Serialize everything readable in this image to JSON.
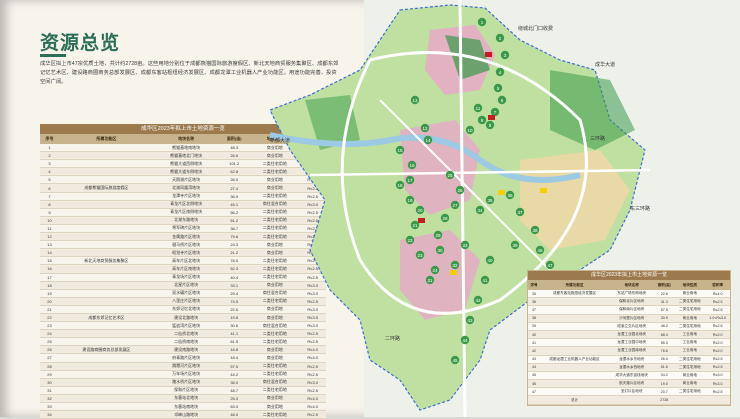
{
  "left_page": {
    "title": "资源总览",
    "intro": "成华区拟上市47宗优质土地，共计约2728亩。这些用地分别位于成都熊猫国际旅游度假区、新北天地商贸服务集聚区、成都东郊记忆艺术区、建设路商圈商务总部发展区、成都东客站枢纽经济发展区、成都龙潭工业机器人产业功能区，用途功能完善，投资空间广阔。",
    "table_title": "成华区2023年拟上市土地资源一览",
    "headers": [
      "序号",
      "所属功能区",
      "地块名称",
      "面积(亩)",
      "地块性质",
      "容积率"
    ],
    "rows": [
      [
        "1",
        "",
        "熊猫基地南地块",
        "48.3",
        "商业用地",
        "R≤2.0"
      ],
      [
        "2",
        "",
        "熊猫基地北门地块",
        "26.6",
        "商业用地",
        "R≤2.0"
      ],
      [
        "3",
        "",
        "熊猫大道西侧地块",
        "101.2",
        "二类住宅用地",
        "R≤2.5"
      ],
      [
        "4",
        "",
        "熊猫大道东侧地块",
        "62.8",
        "二类住宅用地",
        "R≤2.5"
      ],
      [
        "5",
        "",
        "天鹅湖片区地块",
        "26.0",
        "商业用地",
        "R≤3.0"
      ],
      [
        "6",
        "成都熊猫国际旅游度假区",
        "北湖凤凰湾地块",
        "27.4",
        "商业用地",
        "R≤2.0"
      ],
      [
        "7",
        "",
        "龙潭寺片区地块",
        "36.9",
        "二类住宅用地",
        "R≤2.5"
      ],
      [
        "8",
        "",
        "青龙片区北侧地块",
        "45.1",
        "商住混合用地",
        "R≤3.0"
      ],
      [
        "9",
        "",
        "青龙片区南侧地块",
        "56.2",
        "二类住宅用地",
        "R≤2.5"
      ],
      [
        "10",
        "",
        "北湖东路地块",
        "51.2",
        "二类住宅用地",
        "R≤2.5"
      ],
      [
        "11",
        "",
        "将军碑片区地块",
        "38.7",
        "二类住宅用地",
        "R≤2.5"
      ],
      [
        "12",
        "",
        "金属路片区地块",
        "79.6",
        "二类住宅用地",
        "R≤2.5"
      ],
      [
        "13",
        "",
        "驷马桥片区地块",
        "24.3",
        "商业用地",
        "R≤3.5"
      ],
      [
        "14",
        "",
        "昭觉寺片区地块",
        "21.2",
        "商业用地",
        "R≤3.0"
      ],
      [
        "15",
        "新北天地商贸服务集聚区",
        "高车片区北地块",
        "78.0",
        "二类住宅用地",
        "R≤2.5"
      ],
      [
        "16",
        "",
        "高车片区南地块",
        "52.3",
        "二类住宅用地",
        "R≤2.5"
      ],
      [
        "17",
        "",
        "青龙场片区地块",
        "40.4",
        "二类住宅用地",
        "R≤2.5"
      ],
      [
        "18",
        "",
        "北星片区地块",
        "33.1",
        "商业用地",
        "R≤3.0"
      ],
      [
        "19",
        "",
        "双水碾片区地块",
        "29.4",
        "商住混合用地",
        "R≤3.0"
      ],
      [
        "20",
        "",
        "八里庄片区地块",
        "74.5",
        "二类住宅用地",
        "R≤2.5"
      ],
      [
        "21",
        "",
        "东郊记忆北地块",
        "22.6",
        "商业用地",
        "R≤3.0"
      ],
      [
        "22",
        "成都东郊记忆艺术区",
        "建设北路地块",
        "19.6",
        "商业用地",
        "R≤3.5"
      ],
      [
        "23",
        "",
        "猛追湾片区地块",
        "30.6",
        "商住混合用地",
        "R≤3.0"
      ],
      [
        "24",
        "",
        "二仙桥北地块",
        "41.1",
        "二类住宅用地",
        "R≤2.5"
      ],
      [
        "25",
        "",
        "二仙桥南地块",
        "61.5",
        "二类住宅用地",
        "R≤2.5"
      ],
      [
        "26",
        "建设路商圈商务总部发展区",
        "建设南路地块",
        "16.8",
        "商业用地",
        "R≤4.0"
      ],
      [
        "27",
        "",
        "府青路片区地块",
        "18.4",
        "商业用地",
        "R≤4.0"
      ],
      [
        "28",
        "",
        "跳蹬河片区地块",
        "57.9",
        "二类住宅用地",
        "R≤2.5"
      ],
      [
        "29",
        "",
        "万年场片区地块",
        "44.2",
        "二类住宅用地",
        "R≤2.5"
      ],
      [
        "30",
        "",
        "踏水桥片区地块",
        "36.0",
        "商住混合用地",
        "R≤3.0"
      ],
      [
        "31",
        "",
        "保和片区地块",
        "48.7",
        "二类住宅用地",
        "R≤2.5"
      ],
      [
        "32",
        "",
        "东客站北地块",
        "25.3",
        "商业用地",
        "R≤4.0"
      ],
      [
        "33",
        "",
        "东客站南地块",
        "63.0",
        "商业用地",
        "R≤4.0"
      ],
      [
        "34",
        "",
        "邛崃山路地块",
        "48.0",
        "二类住宅用地",
        "R≤2.5"
      ]
    ]
  },
  "right_table": {
    "title": "成华区2023年拟上市土地资源一览",
    "headers": [
      "序号",
      "所属功能区",
      "地块名称",
      "面积(亩)",
      "地块性质",
      "容积率"
    ],
    "rows": [
      [
        "35",
        "成都东客站枢纽经济发展区",
        "东站广场东侧地块",
        "22.6",
        "商业用地",
        "R≤4.0"
      ],
      [
        "36",
        "",
        "保和北片区地块",
        "41.3",
        "二类住宅用地",
        "R≤2.5"
      ],
      [
        "37",
        "",
        "保和南片区地块",
        "57.5",
        "二类住宅用地",
        "R≤2.5"
      ],
      [
        "38",
        "",
        "沙河堡片区地块",
        "30.9",
        "商业用地",
        "1.0<R≤3.0"
      ],
      [
        "39",
        "",
        "成渝立交片区地块",
        "48.2",
        "二类住宅用地",
        "R≤2.5"
      ],
      [
        "40",
        "",
        "龙潭工业园北地块",
        "68.4",
        "工业用地",
        "R≤2.0"
      ],
      [
        "41",
        "",
        "龙潭工业园中地块",
        "55.3",
        "工业用地",
        "R≤2.0"
      ],
      [
        "42",
        "",
        "龙潭工业园南地块",
        "78.6",
        "工业用地",
        "R≤2.0"
      ],
      [
        "43",
        "成都龙潭工业机器人产业功能区",
        "龙潭水乡东地块",
        "26.4",
        "二类住宅用地",
        "R≤2.5"
      ],
      [
        "44",
        "",
        "龙潭水乡西地块",
        "51.8",
        "二类住宅用地",
        "R≤2.5"
      ],
      [
        "45",
        "",
        "成华大道东延线地块",
        "34.2",
        "商业用地",
        "R≤3.0"
      ],
      [
        "46",
        "",
        "航天路片区地块",
        "19.0",
        "商业用地",
        "R≤3.0"
      ],
      [
        "47",
        "",
        "圣灯片区地块",
        "20.7",
        "二类住宅用地",
        "R≤2.5"
      ],
      [
        "",
        "总计",
        "",
        "2728",
        "",
        ""
      ]
    ]
  },
  "map": {
    "road_labels": [
      "绕城北门口收费",
      "成华大道",
      "新都大道",
      "三环路",
      "二环路",
      "东三环路"
    ],
    "parcel_numbers": [
      "1",
      "2",
      "3",
      "4",
      "5",
      "6",
      "7",
      "8",
      "9",
      "10",
      "11",
      "12",
      "13",
      "14",
      "15",
      "16",
      "17",
      "18",
      "19",
      "20",
      "21",
      "22",
      "23",
      "24",
      "25",
      "26",
      "27",
      "28",
      "29",
      "30",
      "31",
      "32",
      "33",
      "34",
      "35",
      "36",
      "37",
      "38",
      "39",
      "40",
      "41",
      "42",
      "43",
      "44",
      "45",
      "46",
      "47"
    ],
    "colors": {
      "green": "#3a9a4a",
      "pink": "#e7a8c8",
      "lightgreen": "#bfe0a0",
      "tan": "#e9d9a6",
      "river": "#9cc9e3",
      "road": "#ffffff",
      "boundary": "#3f6fd0",
      "parcel_red": "#c81c24",
      "parcel_yellow": "#f4d000"
    }
  }
}
